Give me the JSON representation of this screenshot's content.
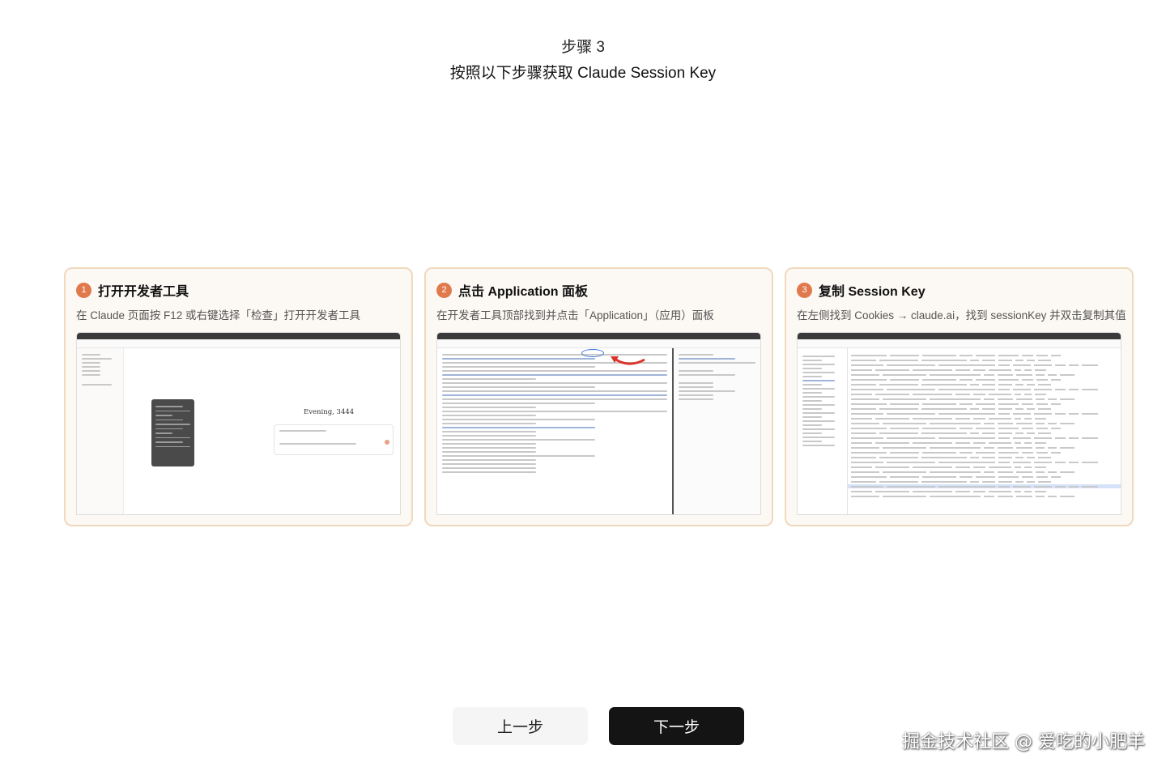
{
  "header": {
    "step_label": "步骤 3",
    "title": "按照以下步骤获取 Claude Session Key"
  },
  "cards": [
    {
      "number": "1",
      "title": "打开开发者工具",
      "description": "在 Claude 页面按 F12 或右键选择「检查」打开开发者工具",
      "screenshot_greeting": "Evening, 3444"
    },
    {
      "number": "2",
      "title": "点击 Application 面板",
      "description": "在开发者工具顶部找到并点击「Application」（应用）面板"
    },
    {
      "number": "3",
      "title": "复制 Session Key",
      "description": "在左侧找到 Cookies → claude.ai，找到 sessionKey 并双击复制其值"
    }
  ],
  "buttons": {
    "prev": "上一步",
    "next": "下一步"
  },
  "watermark": "掘金技术社区 @ 爱吃的小肥羊",
  "colors": {
    "accent": "#e07a4d",
    "card_border": "#f0d9bd",
    "card_bg": "#fcf8f3",
    "primary_button": "#141414"
  }
}
